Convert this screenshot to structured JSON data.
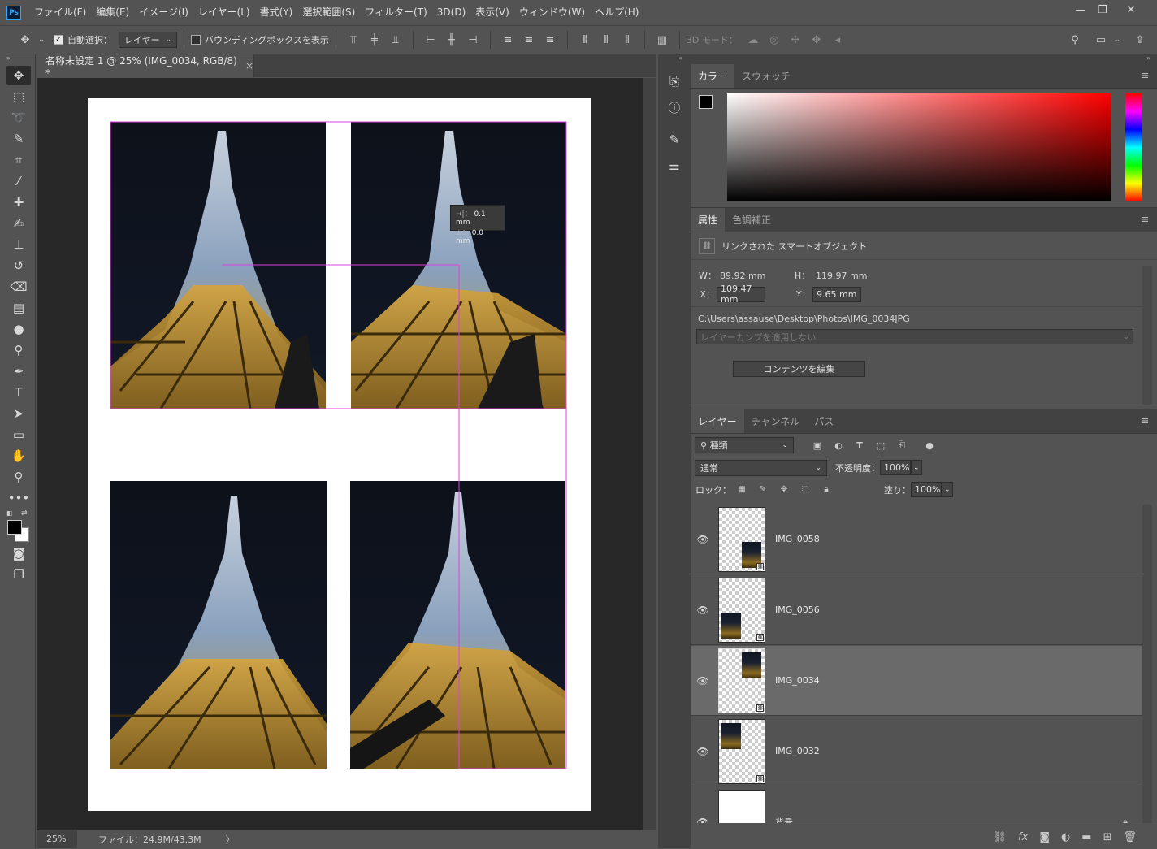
{
  "menubar": {
    "logo": "Ps",
    "items": [
      "ファイル(F)",
      "編集(E)",
      "イメージ(I)",
      "レイヤー(L)",
      "書式(Y)",
      "選択範囲(S)",
      "フィルター(T)",
      "3D(D)",
      "表示(V)",
      "ウィンドウ(W)",
      "ヘルプ(H)"
    ],
    "minimize": "—",
    "maximize": "❐",
    "close": "✕"
  },
  "options": {
    "auto_select_label": "自動選択：",
    "auto_select_target": "レイヤー",
    "bounding_box_label": "バウンディングボックスを表示",
    "mode_3d_label": "3D モード："
  },
  "document": {
    "tab_title": "名称未設定 1 @ 25% (IMG_0034, RGB/8) *",
    "tab_close": "×",
    "measure_dx": "0.1 mm",
    "measure_dy": "0.0 mm"
  },
  "status": {
    "zoom": "25%",
    "file_info": "ファイル：24.9M/43.3M",
    "arrow": "〉"
  },
  "color_panel": {
    "tabs": [
      "カラー",
      "スウォッチ"
    ]
  },
  "properties_panel": {
    "tabs": [
      "属性",
      "色調補正"
    ],
    "type_label": "リンクされた スマートオブジェクト",
    "w_label": "W：",
    "w_value": "89.92 mm",
    "h_label": "H：",
    "h_value": "119.97 mm",
    "x_label": "X：",
    "x_value": "109.47 mm",
    "y_label": "Y：",
    "y_value": "9.65 mm",
    "path": "C:\\Users\\assause\\Desktop\\Photos\\IMG_0034JPG",
    "layer_comp": "レイヤーカンプを適用しない",
    "edit_button": "コンテンツを編集"
  },
  "layers_panel": {
    "tabs": [
      "レイヤー",
      "チャンネル",
      "パス"
    ],
    "filter_kind": "種類",
    "blend_mode": "通常",
    "opacity_label": "不透明度：",
    "opacity_value": "100%",
    "lock_label": "ロック：",
    "fill_label": "塗り：",
    "fill_value": "100%",
    "layers": [
      {
        "name": "IMG_0058",
        "selected": false
      },
      {
        "name": "IMG_0056",
        "selected": false
      },
      {
        "name": "IMG_0034",
        "selected": true
      },
      {
        "name": "IMG_0032",
        "selected": false
      },
      {
        "name": "背景",
        "selected": false
      }
    ]
  },
  "colors": {
    "foreground": "#000000",
    "background": "#ffffff",
    "guide": "#e040e0",
    "hue_top": "#ff0000"
  }
}
